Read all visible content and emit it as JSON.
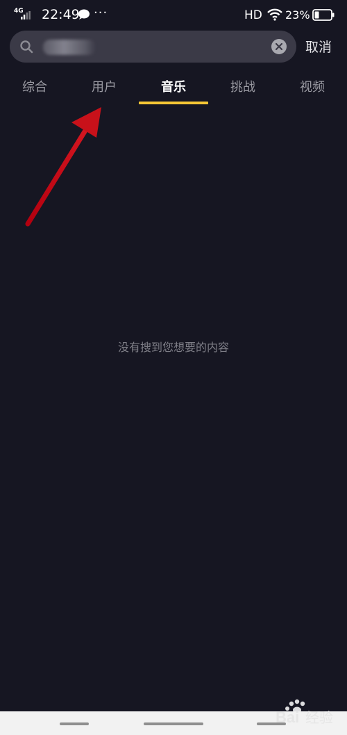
{
  "status_bar": {
    "network": "4G",
    "time": "22:49",
    "more": "···",
    "hd": "HD",
    "battery": "23%"
  },
  "search": {
    "query": "",
    "cancel_label": "取消"
  },
  "tabs": [
    {
      "label": "综合",
      "active": false
    },
    {
      "label": "用户",
      "active": false
    },
    {
      "label": "音乐",
      "active": true
    },
    {
      "label": "挑战",
      "active": false
    },
    {
      "label": "视频",
      "active": false
    }
  ],
  "empty_state": {
    "message": "没有搜到您想要的内容"
  },
  "colors": {
    "background": "#161622",
    "search_background": "#3b3a47",
    "active_indicator": "#f7c735",
    "annotation_arrow": "#c8111a"
  },
  "icons": {
    "search": "search-icon",
    "clear": "close-circle-icon",
    "wifi": "wifi-icon",
    "battery": "battery-icon",
    "message": "message-bubble-icon",
    "signal": "cell-signal-icon"
  },
  "watermark": {
    "brand": "Bai",
    "text": "经验"
  }
}
